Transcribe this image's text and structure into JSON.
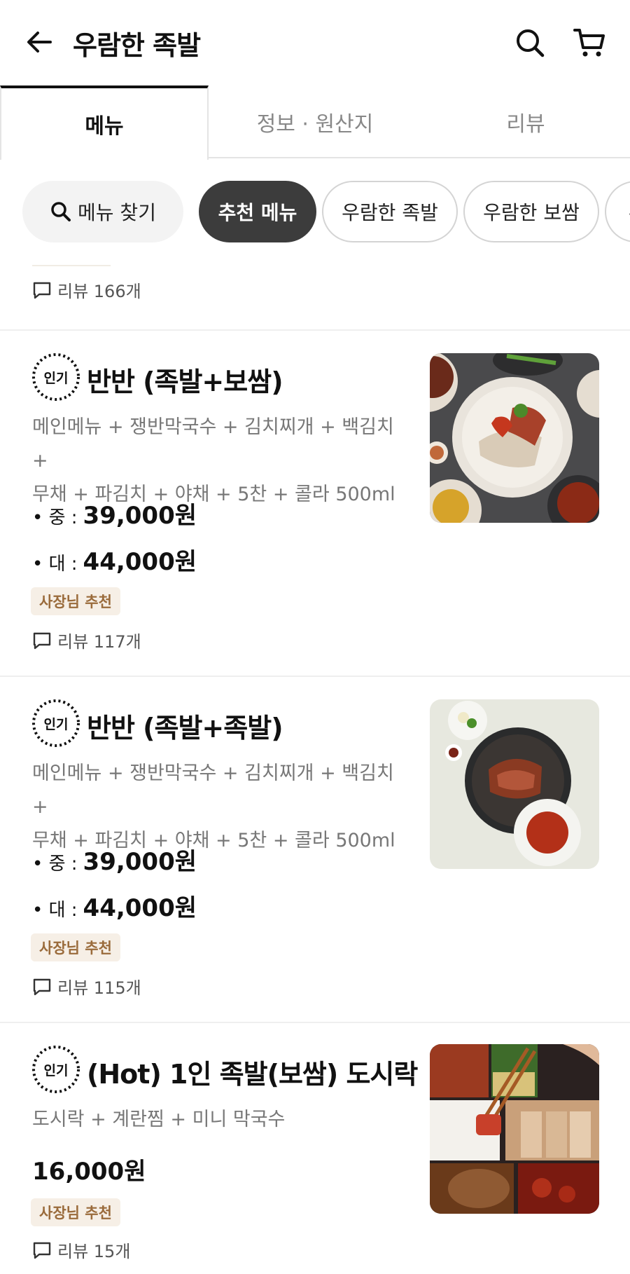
{
  "header": {
    "title": "우람한 족발",
    "back_icon": "arrow-left-icon",
    "search_icon": "search-icon",
    "cart_icon": "cart-icon"
  },
  "tabs": [
    {
      "label": "메뉴",
      "active": true
    },
    {
      "label": "정보 · 원산지",
      "active": false
    },
    {
      "label": "리뷰",
      "active": false
    }
  ],
  "chips": {
    "search_label": "메뉴 찾기",
    "items": [
      {
        "label": "추천 메뉴",
        "active": true
      },
      {
        "label": "우람한 족발",
        "active": false
      },
      {
        "label": "우람한 보쌈",
        "active": false
      },
      {
        "label": "우",
        "active": false
      }
    ]
  },
  "partial_item": {
    "review_label": "리뷰 166개"
  },
  "items": [
    {
      "popular_badge": "인기",
      "name": "반반 (족발+보쌈)",
      "desc_line1": "메인메뉴 + 쟁반막국수 + 김치찌개 + 백김치 +",
      "desc_line2": "무채 + 파김치 + 야채 + 5찬 + 콜라 500ml",
      "prices": [
        {
          "label": "• 중 :",
          "value": "39,000원"
        },
        {
          "label": "• 대 :",
          "value": "44,000원"
        }
      ],
      "owner_badge": "사장님 추천",
      "review_label": "리뷰 117개"
    },
    {
      "popular_badge": "인기",
      "name": "반반 (족발+족발)",
      "desc_line1": "메인메뉴 + 쟁반막국수 + 김치찌개 + 백김치 +",
      "desc_line2": "무채 + 파김치 + 야채 + 5찬 + 콜라 500ml",
      "prices": [
        {
          "label": "• 중 :",
          "value": "39,000원"
        },
        {
          "label": "• 대 :",
          "value": "44,000원"
        }
      ],
      "owner_badge": "사장님 추천",
      "review_label": "리뷰 115개"
    },
    {
      "popular_badge": "인기",
      "name": "(Hot) 1인 족발(보쌈) 도시락",
      "desc_line1": "도시락 + 계란찜 + 미니 막국수",
      "price": "16,000원",
      "owner_badge": "사장님 추천",
      "review_label": "리뷰 15개"
    }
  ],
  "colors": {
    "accent_dark": "#3c3c3c",
    "owner_badge_bg": "#f6efe6",
    "owner_badge_text": "#9a6b3b"
  }
}
